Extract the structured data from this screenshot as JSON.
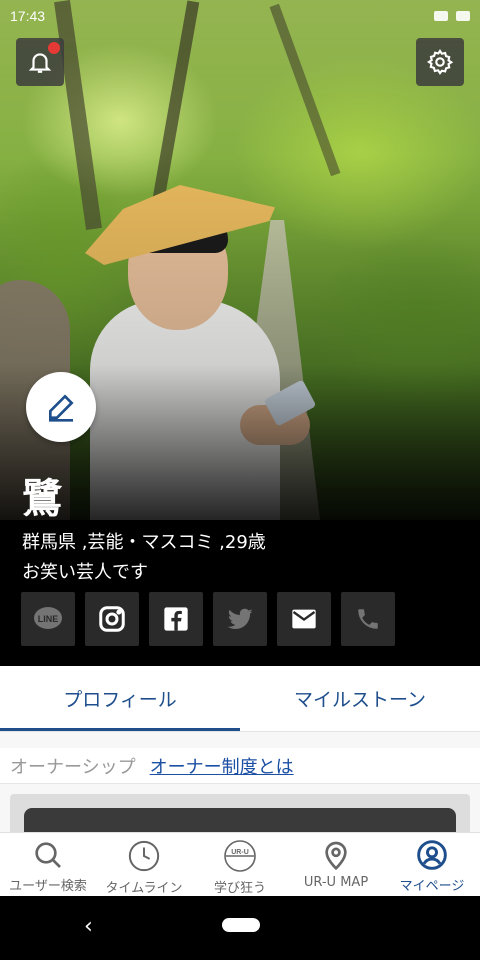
{
  "status_bar": {
    "time": "17:43"
  },
  "profile": {
    "name": "鷺",
    "meta": "群馬県 ,芸能・マスコミ ,29歳",
    "bio": "お笑い芸人です"
  },
  "socials": [
    {
      "icon": "line-icon",
      "label": "LINE",
      "enabled": false
    },
    {
      "icon": "instagram-icon",
      "enabled": true
    },
    {
      "icon": "facebook-icon",
      "enabled": true
    },
    {
      "icon": "twitter-icon",
      "enabled": false
    },
    {
      "icon": "mail-icon",
      "enabled": true
    },
    {
      "icon": "phone-icon",
      "enabled": false
    }
  ],
  "tabs": [
    {
      "label": "プロフィール",
      "active": true
    },
    {
      "label": "マイルストーン",
      "active": false
    }
  ],
  "ownership": {
    "label": "オーナーシップ",
    "link": "オーナー制度とは"
  },
  "bottom_nav": [
    {
      "label": "ユーザー検索",
      "icon": "search-icon"
    },
    {
      "label": "タイムライン",
      "icon": "clock-icon"
    },
    {
      "label": "学び狂う",
      "icon": "ur-u-logo-icon",
      "icon_text": "UR-U"
    },
    {
      "label": "UR-U MAP",
      "icon": "map-pin-icon"
    },
    {
      "label": "マイページ",
      "icon": "user-icon",
      "active": true
    }
  ],
  "colors": {
    "accent": "#1e4e8c",
    "notification": "#e53935"
  }
}
